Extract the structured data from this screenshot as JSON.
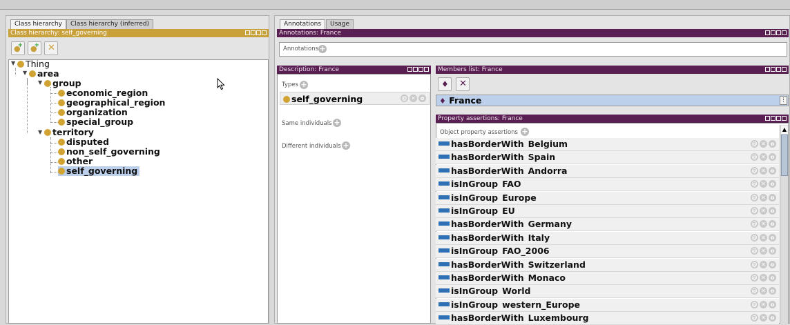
{
  "left": {
    "tabs": [
      "Class hierarchy",
      "Class hierarchy (inferred)"
    ],
    "panel_title": "Class hierarchy: self_governing",
    "tree": [
      {
        "label": "Thing",
        "depth": 0
      },
      {
        "label": "area",
        "depth": 1
      },
      {
        "label": "group",
        "depth": 2
      },
      {
        "label": "economic_region",
        "depth": 3
      },
      {
        "label": "geographical_region",
        "depth": 3
      },
      {
        "label": "organization",
        "depth": 3
      },
      {
        "label": "special_group",
        "depth": 3
      },
      {
        "label": "territory",
        "depth": 2
      },
      {
        "label": "disputed",
        "depth": 3
      },
      {
        "label": "non_self_governing",
        "depth": 3
      },
      {
        "label": "other",
        "depth": 3
      },
      {
        "label": "self_governing",
        "depth": 3,
        "selected": true
      }
    ]
  },
  "right": {
    "tabs": [
      "Annotations",
      "Usage"
    ],
    "annotations_title": "Annotations: France",
    "annotations_label": "Annotations",
    "description_title": "Description: France",
    "types_label": "Types",
    "type_value": "self_governing",
    "same_label": "Same individuals",
    "different_label": "Different individuals",
    "members_title": "Members list: France",
    "member_value": "France",
    "property_title": "Property assertions: France",
    "object_assertions_label": "Object property assertions",
    "assertions": [
      {
        "property": "hasBorderWith",
        "value": "Belgium"
      },
      {
        "property": "hasBorderWith",
        "value": "Spain"
      },
      {
        "property": "hasBorderWith",
        "value": "Andorra"
      },
      {
        "property": "isInGroup",
        "value": "FAO"
      },
      {
        "property": "isInGroup",
        "value": "Europe"
      },
      {
        "property": "isInGroup",
        "value": "EU"
      },
      {
        "property": "hasBorderWith",
        "value": "Germany"
      },
      {
        "property": "hasBorderWith",
        "value": "Italy"
      },
      {
        "property": "isInGroup",
        "value": "FAO_2006"
      },
      {
        "property": "hasBorderWith",
        "value": "Switzerland"
      },
      {
        "property": "hasBorderWith",
        "value": "Monaco"
      },
      {
        "property": "isInGroup",
        "value": "World"
      },
      {
        "property": "isInGroup",
        "value": "western_Europe"
      },
      {
        "property": "hasBorderWith",
        "value": "Luxembourg"
      }
    ]
  }
}
